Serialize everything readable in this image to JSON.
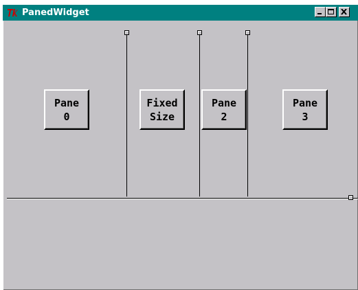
{
  "window": {
    "title": "PanedWidget",
    "title_icon": "tk-icon"
  },
  "title_controls": {
    "minimize": "minimize-icon",
    "maximize": "maximize-icon",
    "close": "close-icon"
  },
  "panes": [
    {
      "label": "Pane\n0"
    },
    {
      "label": "Fixed\nSize"
    },
    {
      "label": "Pane\n2"
    },
    {
      "label": "Pane\n3"
    }
  ],
  "colors": {
    "titlebar": "#008080",
    "background": "#c4c2c6"
  }
}
